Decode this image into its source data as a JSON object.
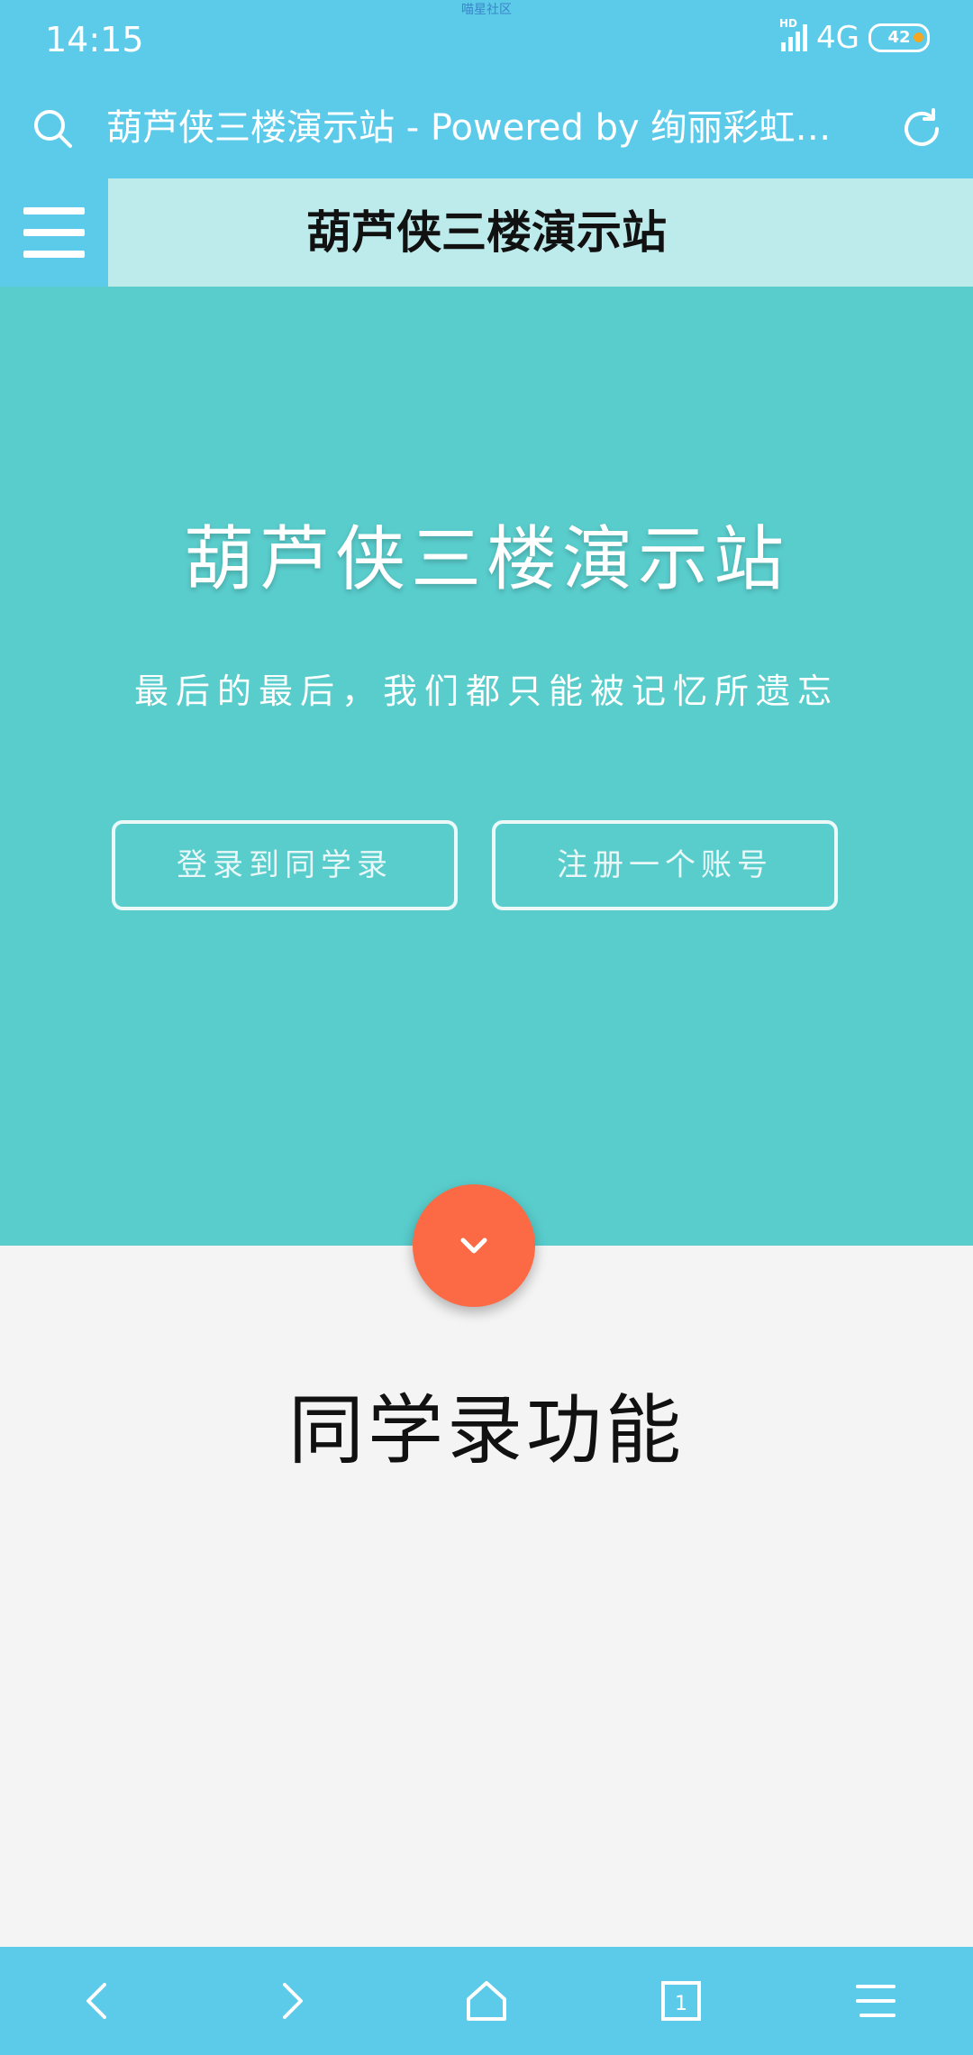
{
  "status_bar": {
    "time": "14:15",
    "watermark": "喵星社区",
    "network": "4G",
    "hd_label": "HD",
    "battery": "42"
  },
  "address_bar": {
    "page_title": "葫芦侠三楼演示站 - Powered by 绚丽彩虹…",
    "icons": [
      "search-icon",
      "refresh-icon"
    ]
  },
  "site_header": {
    "title": "葫芦侠三楼演示站"
  },
  "hero": {
    "title": "葫芦侠三楼演示站",
    "subtitle": "最后的最后，我们都只能被记忆所遗忘",
    "login_button": "登录到同学录",
    "register_button": "注册一个账号",
    "background_color": "#59cdcc"
  },
  "section": {
    "title": "同学录功能"
  },
  "bottom_nav": {
    "tab_count": "1",
    "icons": [
      "back-icon",
      "forward-icon",
      "home-icon",
      "tabs-icon",
      "menu-icon"
    ]
  },
  "colors": {
    "browser_bar": "#5ccae9",
    "header_bg": "#bdeaea",
    "fab": "#fb6a45",
    "page_bg": "#f4f4f4"
  }
}
